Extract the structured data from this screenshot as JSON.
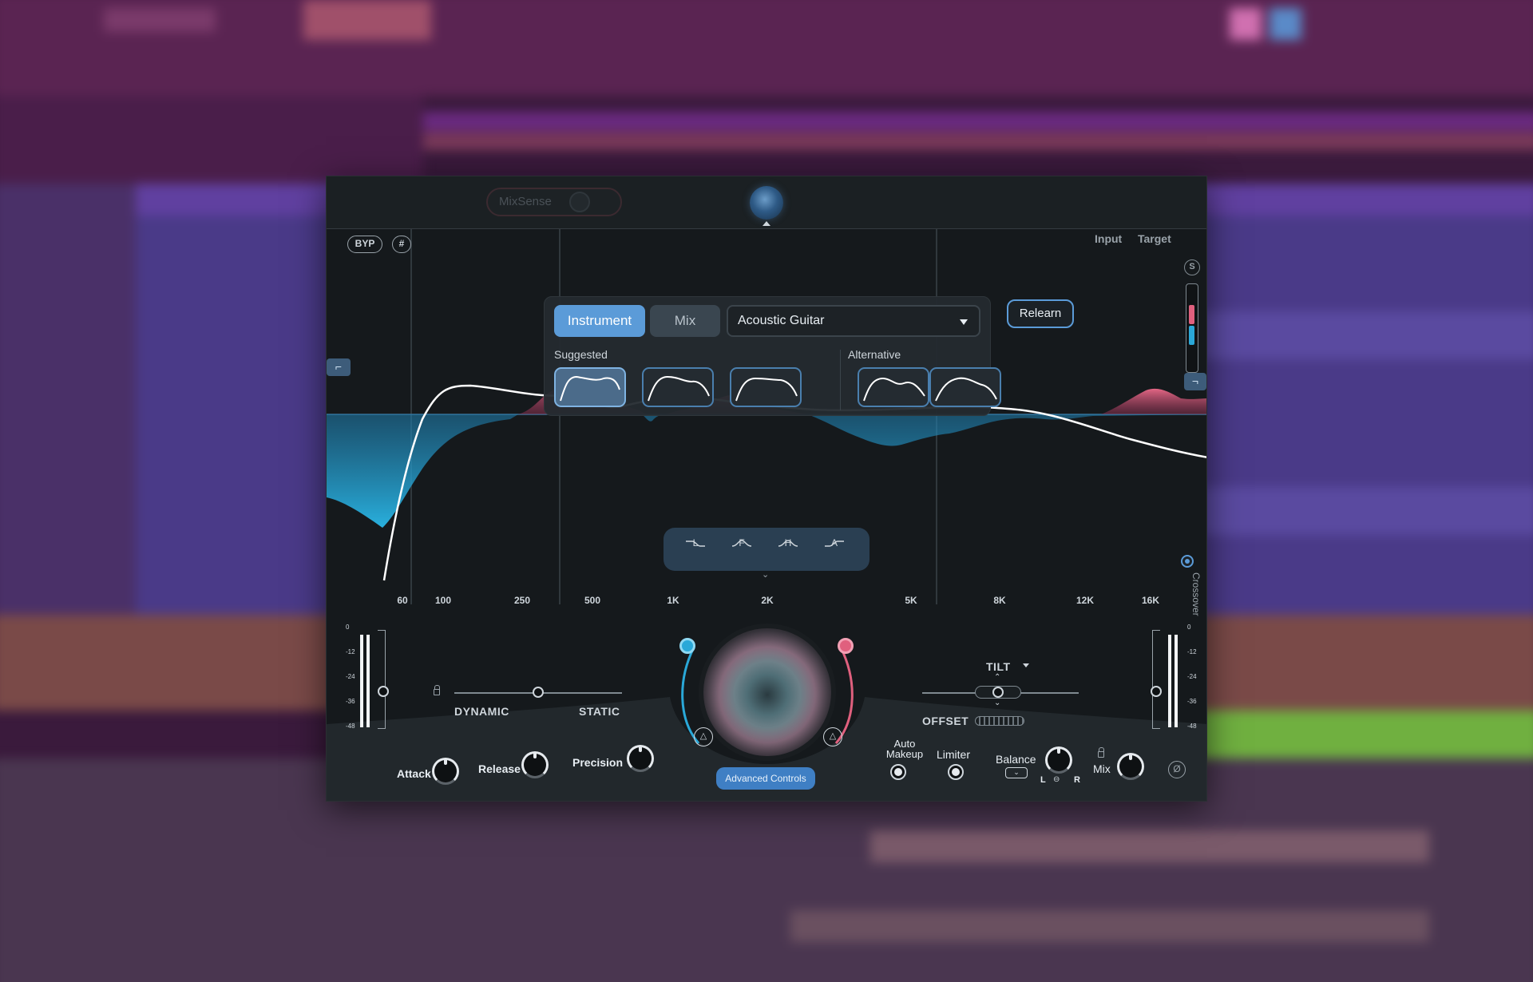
{
  "plugin": {
    "mixsense_label": "MixSense",
    "bypass_label": "BYP",
    "grid_icon": "grid-icon",
    "input_label": "Input",
    "target_label": "Target",
    "s_label": "S",
    "crossover_label": "Crossover"
  },
  "instrument_panel": {
    "tabs": [
      {
        "label": "Instrument",
        "active": true
      },
      {
        "label": "Mix",
        "active": false
      }
    ],
    "instrument": "Acoustic Guitar",
    "suggested_label": "Suggested",
    "alternative_label": "Alternative",
    "relearn_label": "Relearn"
  },
  "band_bar": {
    "bands": [
      "L",
      "F",
      "H",
      "A"
    ]
  },
  "frequency_axis": [
    "60",
    "100",
    "250",
    "500",
    "1K",
    "2K",
    "5K",
    "8K",
    "12K",
    "16K"
  ],
  "meter_scale": [
    "0",
    "-12",
    "-24",
    "-36",
    "-48"
  ],
  "controls": {
    "dynamic_label": "DYNAMIC",
    "static_label": "STATIC",
    "attack_label": "Attack",
    "release_label": "Release",
    "precision_label": "Precision",
    "advanced_label": "Advanced Controls",
    "tilt_label": "TILT",
    "offset_label": "OFFSET",
    "auto_makeup_label_1": "Auto",
    "auto_makeup_label_2": "Makeup",
    "limiter_label": "Limiter",
    "balance_label": "Balance",
    "balance_l": "L",
    "balance_r": "R",
    "mix_label": "Mix",
    "phase_icon": "Ø",
    "dynamic_static_value": 0.5
  },
  "colors": {
    "accent_blue": "#5b9bd8",
    "boost_pink": "#e0607e",
    "cut_cyan": "#2aa8d8",
    "curve_white": "#ffffff"
  }
}
